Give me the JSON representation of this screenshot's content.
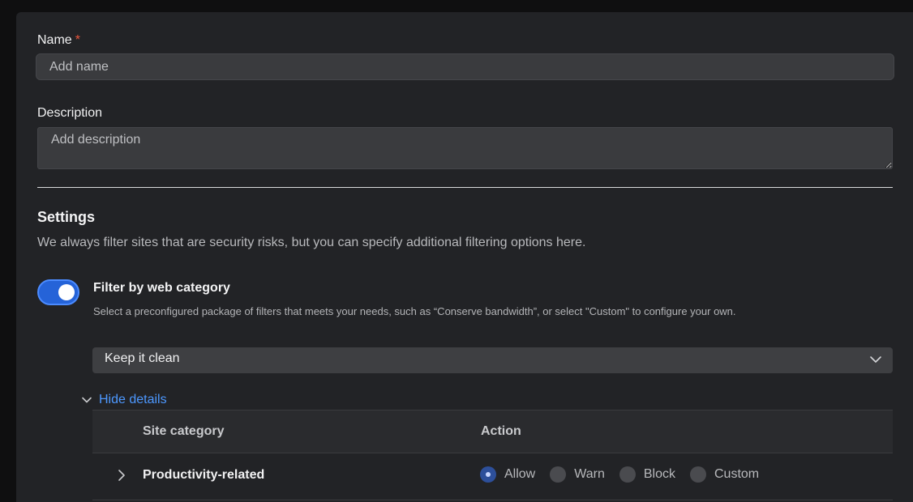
{
  "form": {
    "name_label": "Name",
    "name_required": "*",
    "name_placeholder": "Add name",
    "description_label": "Description",
    "description_placeholder": "Add description"
  },
  "settings": {
    "heading": "Settings",
    "help": "We always filter sites that are security risks, but you can specify additional filtering options here.",
    "filter_toggle": {
      "title": "Filter by web category",
      "description": "Select a preconfigured package of filters that meets your needs, such as “Conserve bandwidth”, or select \"Custom\" to configure your own.",
      "enabled": true
    },
    "package_select": {
      "value": "Keep it clean"
    },
    "details_toggle": "Hide details",
    "table": {
      "columns": [
        "Site category",
        "Action"
      ],
      "rows": [
        {
          "category": "Productivity-related",
          "actions": [
            "Allow",
            "Warn",
            "Block",
            "Custom"
          ],
          "selected": "Allow"
        }
      ]
    }
  },
  "colors": {
    "accent": "#2563d8",
    "link": "#4d98ff",
    "required": "#e9553c"
  },
  "icons": {
    "select": "chevron-down-icon",
    "details": "chevron-down-icon",
    "row": "chevron-right-icon"
  }
}
